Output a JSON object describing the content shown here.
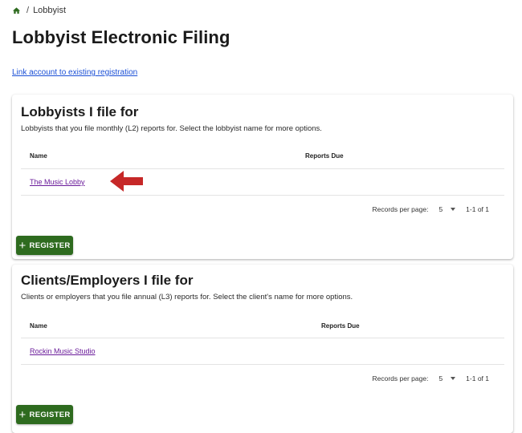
{
  "breadcrumb": {
    "home_icon": "home-icon",
    "separator": "/",
    "current": "Lobbyist"
  },
  "page": {
    "title": "Lobbyist Electronic Filing",
    "link_account": "Link account to existing registration"
  },
  "lobbyists_section": {
    "title": "Lobbyists I file for",
    "description": "Lobbyists that you file monthly (L2) reports for. Select the lobbyist name for more options.",
    "columns": [
      "Name",
      "Reports Due"
    ],
    "rows": [
      {
        "name": "The Music Lobby",
        "reports_due": ""
      }
    ],
    "pager": {
      "label": "Records per page:",
      "per_page": "5",
      "range": "1-1 of 1"
    },
    "register_label": "REGISTER"
  },
  "clients_section": {
    "title": "Clients/Employers I file for",
    "description": "Clients or employers that you file annual (L3) reports for. Select the client's name for more options.",
    "columns": [
      "Name",
      "Reports Due"
    ],
    "rows": [
      {
        "name": "Rockin Music Studio",
        "reports_due": ""
      }
    ],
    "pager": {
      "label": "Records per page:",
      "per_page": "5",
      "range": "1-1 of 1"
    },
    "register_label": "REGISTER"
  },
  "colors": {
    "accent_green": "#2e6b1f",
    "link_blue": "#1a4fd6",
    "visited_purple": "#6a1b9a",
    "annotation_arrow": "#c62828"
  }
}
